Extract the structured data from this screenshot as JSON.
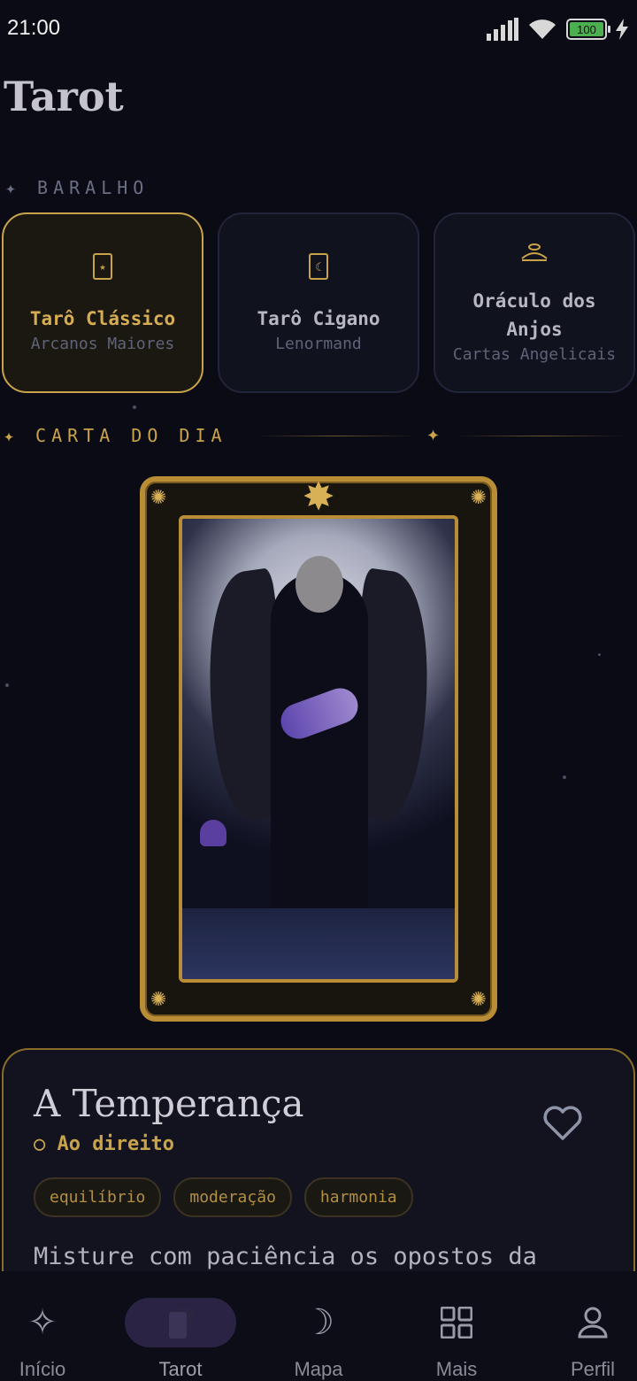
{
  "status_bar": {
    "time": "21:00",
    "battery": "100"
  },
  "page": {
    "title": "Tarot"
  },
  "deck_section": {
    "label": "BARALHO",
    "decks": [
      {
        "name": "Tarô Clássico",
        "subtitle": "Arcanos Maiores",
        "icon": "star-card-icon",
        "selected": true
      },
      {
        "name": "Tarô Cigano",
        "subtitle": "Lenormand",
        "icon": "moon-card-icon",
        "selected": false
      },
      {
        "name": "Oráculo dos Anjos",
        "subtitle": "Cartas Angelicais",
        "icon": "halo-icon",
        "selected": false
      }
    ]
  },
  "daily_section": {
    "label": "CARTA DO DIA"
  },
  "daily_card": {
    "name": "A Temperança",
    "orientation": "Ao direito",
    "tags": [
      "equilíbrio",
      "moderação",
      "harmonia"
    ],
    "description": "Misture com paciência os opostos da"
  },
  "bottom_nav": [
    {
      "label": "Início",
      "icon": "sparkles-icon",
      "active": false
    },
    {
      "label": "Tarot",
      "icon": "cards-icon",
      "active": true
    },
    {
      "label": "Mapa",
      "icon": "moon-icon",
      "active": false
    },
    {
      "label": "Mais",
      "icon": "grid-icon",
      "active": false
    },
    {
      "label": "Perfil",
      "icon": "person-icon",
      "active": false
    }
  ],
  "colors": {
    "accent": "#c9a34a",
    "background": "#0a0b14",
    "nav_active": "#2a2344"
  }
}
